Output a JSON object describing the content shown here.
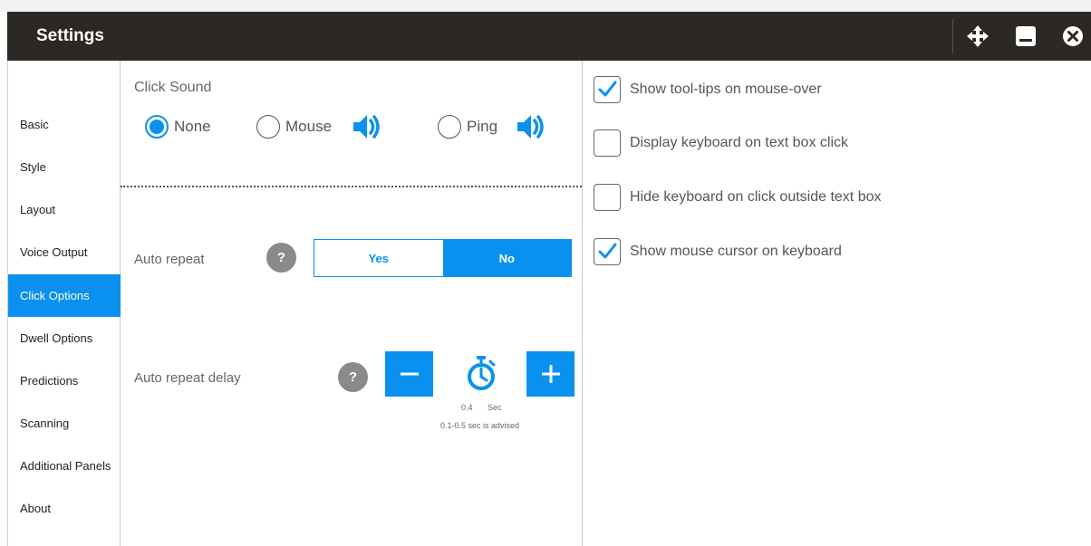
{
  "window": {
    "title": "Settings"
  },
  "sidebar": {
    "items": [
      {
        "label": "Basic"
      },
      {
        "label": "Style"
      },
      {
        "label": "Layout"
      },
      {
        "label": "Voice Output"
      },
      {
        "label": "Click Options"
      },
      {
        "label": "Dwell Options"
      },
      {
        "label": "Predictions"
      },
      {
        "label": "Scanning"
      },
      {
        "label": "Additional Panels"
      },
      {
        "label": "About"
      }
    ],
    "active": "Click Options"
  },
  "click_sound": {
    "label": "Click Sound",
    "options": [
      {
        "label": "None",
        "checked": true
      },
      {
        "label": "Mouse",
        "checked": false
      },
      {
        "label": "Ping",
        "checked": false
      }
    ]
  },
  "auto_repeat": {
    "label": "Auto repeat",
    "help": "?",
    "yes_label": "Yes",
    "no_label": "No",
    "selected": "No"
  },
  "auto_repeat_delay": {
    "label": "Auto repeat delay",
    "help": "?",
    "value": "0.4",
    "unit": "Sec",
    "hint": "0.1-0.5 sec is advised"
  },
  "options": {
    "items": [
      {
        "label": "Show tool-tips on mouse-over",
        "checked": true
      },
      {
        "label": "Display keyboard on text box click",
        "checked": false
      },
      {
        "label": "Hide keyboard on click outside text box",
        "checked": false
      },
      {
        "label": "Show mouse cursor on keyboard",
        "checked": true
      }
    ]
  },
  "colors": {
    "accent": "#0a91f0",
    "titlebar": "#2c2824",
    "help": "#8a8a8a"
  }
}
